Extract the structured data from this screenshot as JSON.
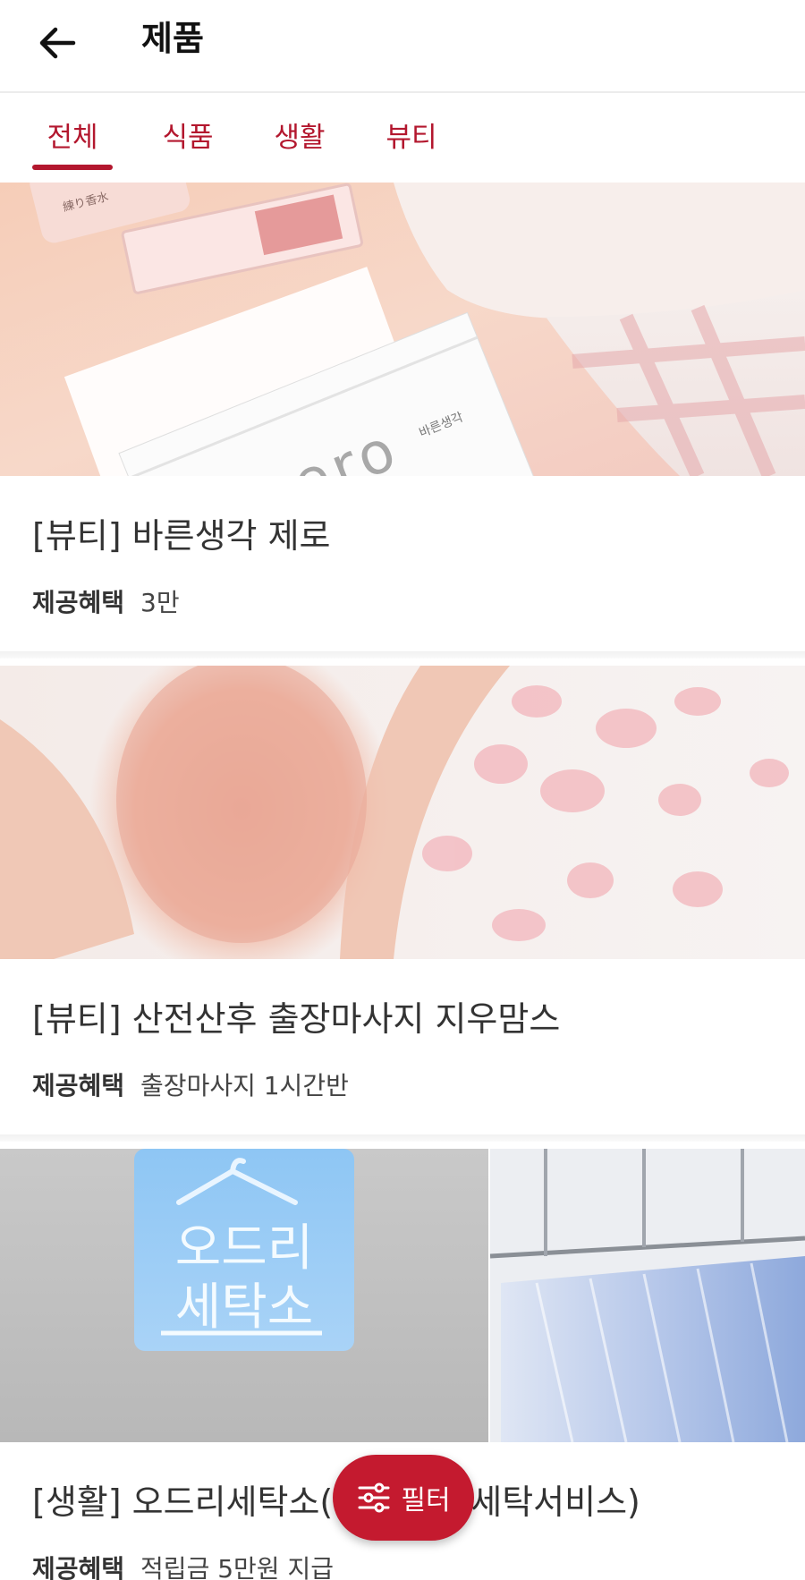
{
  "header": {
    "title": "제품",
    "back_icon": "arrow-left-icon"
  },
  "tabs": [
    {
      "label": "전체",
      "active": true
    },
    {
      "label": "식품",
      "active": false
    },
    {
      "label": "생활",
      "active": false
    },
    {
      "label": "뷰티",
      "active": false
    }
  ],
  "products": [
    {
      "title": "[뷰티] 바른생각 제로",
      "benefit_label": "제공혜택",
      "benefit_value": "3만",
      "image": {
        "pouch_text": "zero",
        "pouch_label": "바른생각",
        "tube_label": "練り香水"
      }
    },
    {
      "title": "[뷰티] 산전산후 출장마사지 지우맘스",
      "benefit_label": "제공혜택",
      "benefit_value": "출장마사지 1시간반"
    },
    {
      "title": "[생활] 오드리세탁소(",
      "title_tail": "세탁서비스)",
      "benefit_label": "제공혜택",
      "benefit_value": "적립금 5만원 지급",
      "image": {
        "sign_line1": "오드리",
        "sign_line2": "세탁소"
      }
    }
  ],
  "filter_button": {
    "label": "필터",
    "icon": "sliders-icon"
  },
  "colors": {
    "accent": "#b3172e",
    "fab": "#c41a2f"
  }
}
